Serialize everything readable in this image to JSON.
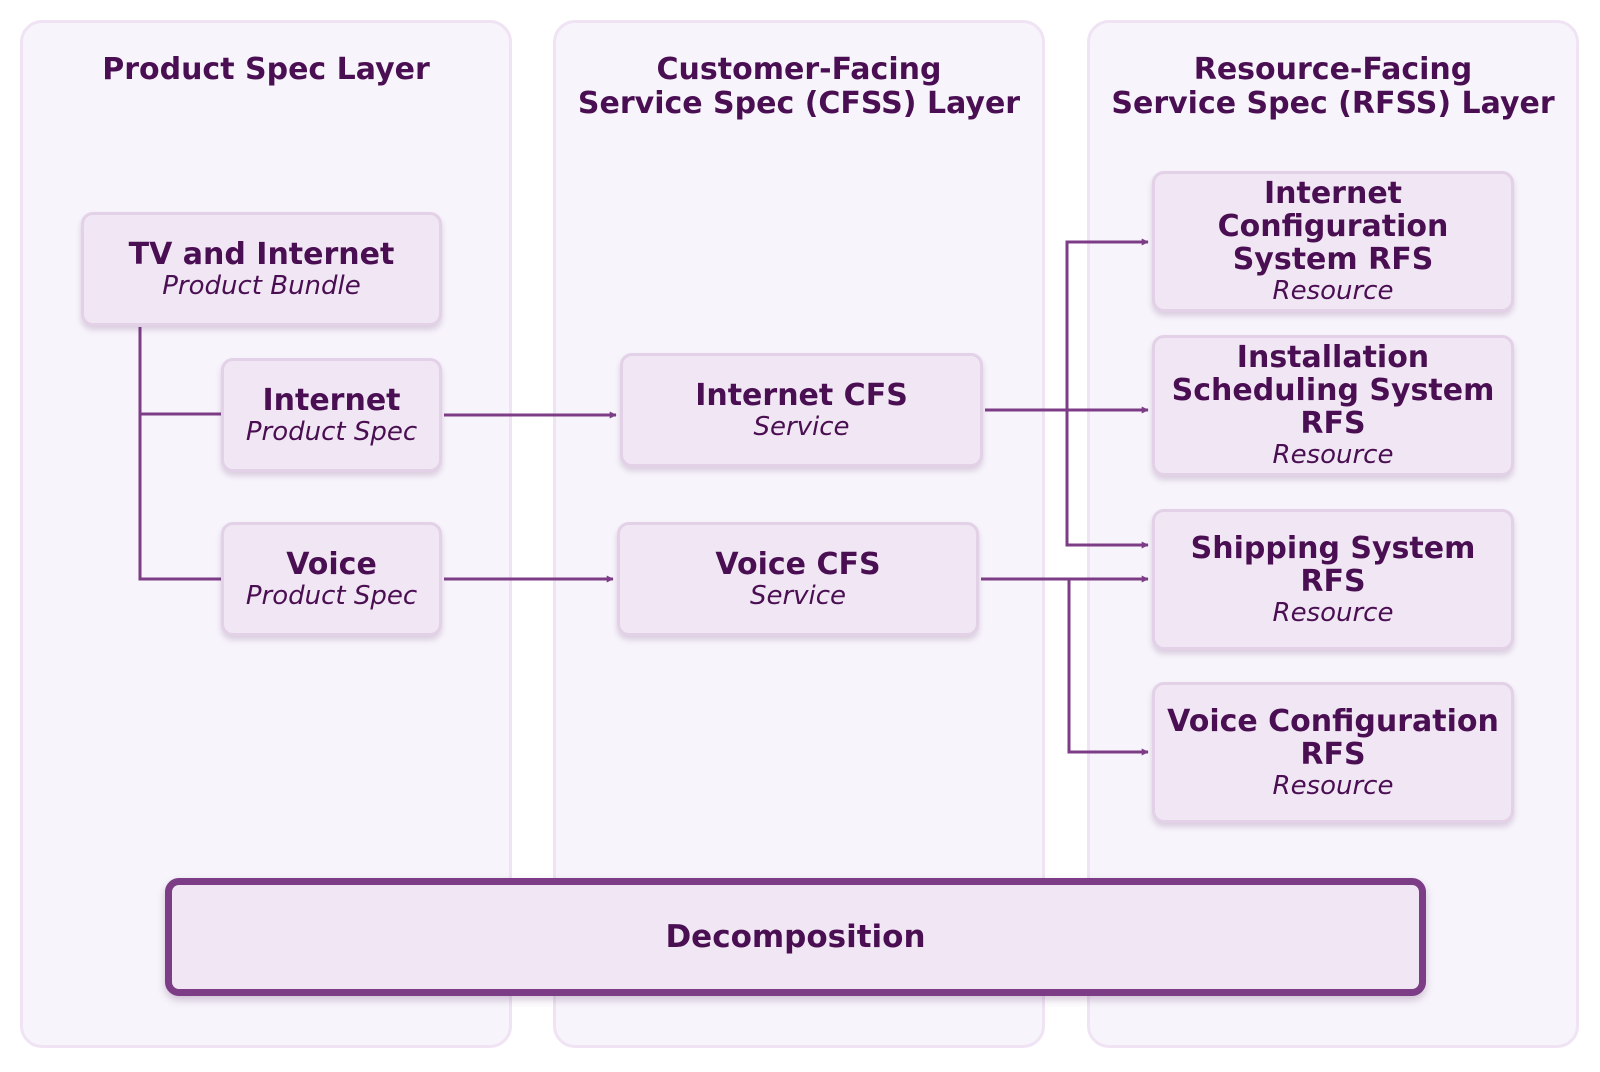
{
  "colors": {
    "layer_bg": "#f7f4fb",
    "node_bg": "#f1e6f3",
    "text": "#4a0f52",
    "connector": "#7c3d86"
  },
  "layers": [
    {
      "id": "product",
      "title": "Product Spec Layer"
    },
    {
      "id": "cfss",
      "title": "Customer-Facing\nService Spec (CFSS) Layer"
    },
    {
      "id": "rfss",
      "title": "Resource-Facing\nService Spec (RFSS) Layer"
    }
  ],
  "nodes": {
    "tv_bundle": {
      "title": "TV and Internet",
      "subtitle": "Product Bundle"
    },
    "internet_spec": {
      "title": "Internet",
      "subtitle": "Product Spec"
    },
    "voice_spec": {
      "title": "Voice",
      "subtitle": "Product Spec"
    },
    "internet_cfs": {
      "title": "Internet CFS",
      "subtitle": "Service"
    },
    "voice_cfs": {
      "title": "Voice CFS",
      "subtitle": "Service"
    },
    "internet_config_rfs": {
      "title": "Internet\nConfiguration\nSystem RFS",
      "subtitle": "Resource"
    },
    "install_sched_rfs": {
      "title": "Installation\nScheduling System\nRFS",
      "subtitle": "Resource"
    },
    "shipping_rfs": {
      "title": "Shipping System\nRFS",
      "subtitle": "Resource"
    },
    "voice_config_rfs": {
      "title": "Voice Configuration\nRFS",
      "subtitle": "Resource"
    }
  },
  "edges": [
    {
      "from": "tv_bundle",
      "to": "internet_spec",
      "type": "hierarchy"
    },
    {
      "from": "tv_bundle",
      "to": "voice_spec",
      "type": "hierarchy"
    },
    {
      "from": "internet_spec",
      "to": "internet_cfs",
      "type": "arrow"
    },
    {
      "from": "voice_spec",
      "to": "voice_cfs",
      "type": "arrow"
    },
    {
      "from": "internet_cfs",
      "to": "internet_config_rfs",
      "type": "arrow"
    },
    {
      "from": "internet_cfs",
      "to": "install_sched_rfs",
      "type": "arrow"
    },
    {
      "from": "internet_cfs",
      "to": "shipping_rfs",
      "type": "arrow"
    },
    {
      "from": "voice_cfs",
      "to": "shipping_rfs",
      "type": "arrow"
    },
    {
      "from": "voice_cfs",
      "to": "voice_config_rfs",
      "type": "arrow"
    }
  ],
  "footer": {
    "label": "Decomposition"
  }
}
